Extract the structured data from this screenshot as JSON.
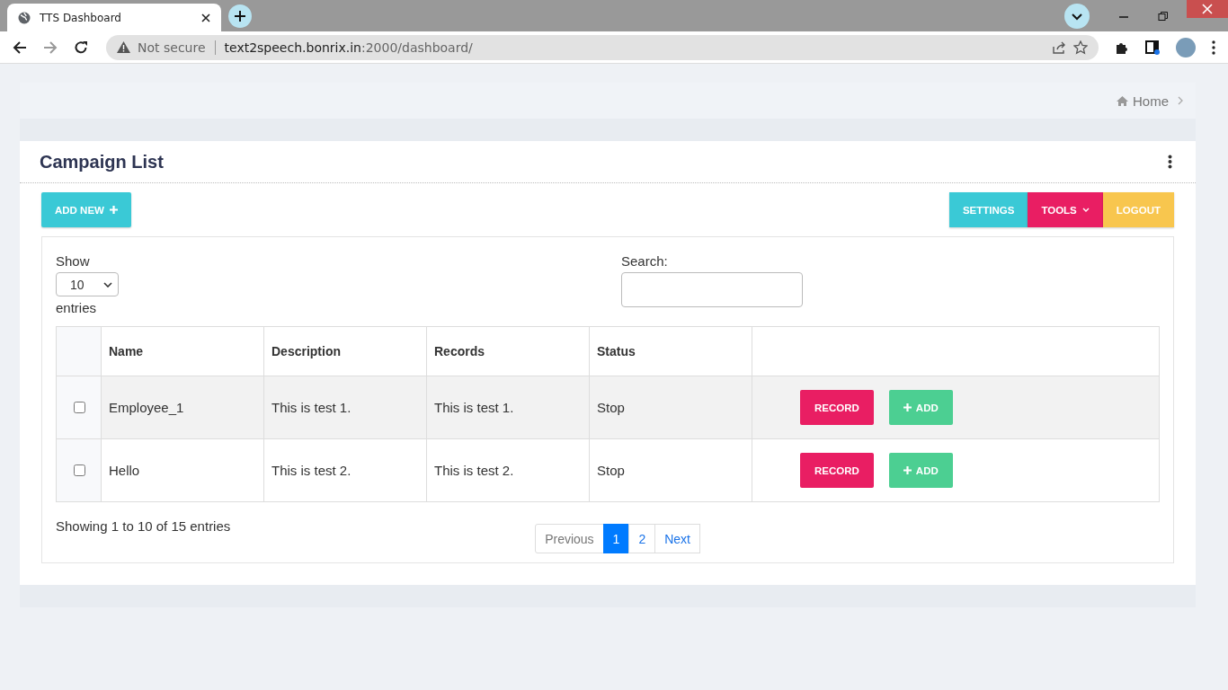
{
  "browser": {
    "tab_title": "TTS Dashboard",
    "security": "Not secure",
    "url_host": "text2speech.bonrix.in",
    "url_path": ":2000/dashboard/"
  },
  "breadcrumb": {
    "label": "Home"
  },
  "card": {
    "title": "Campaign List"
  },
  "toolbar": {
    "add_new": "ADD NEW",
    "buttons": [
      {
        "label": "SETTINGS",
        "kind": "settings"
      },
      {
        "label": "TOOLS",
        "kind": "tools"
      },
      {
        "label": "LOGOUT",
        "kind": "logout"
      }
    ]
  },
  "length_menu": {
    "show": "Show",
    "value": "10",
    "entries": "entries"
  },
  "search": {
    "label": "Search:"
  },
  "table": {
    "columns": [
      "Name",
      "Description",
      "Records",
      "Status"
    ],
    "rows": [
      {
        "checked": false,
        "name": "Employee_1",
        "description": "This is test 1.",
        "records": "This is test 1.",
        "status": "Stop",
        "record_button": "RECORD",
        "add_button": "ADD"
      },
      {
        "checked": false,
        "name": "Hello",
        "description": "This is test 2.",
        "records": "This is test 2.",
        "status": "Stop",
        "record_button": "RECORD",
        "add_button": "ADD"
      }
    ]
  },
  "info": "Showing 1 to 10 of 15 entries",
  "pagination": {
    "previous": "Previous",
    "pages": [
      {
        "label": "1",
        "selected": true
      },
      {
        "label": "2",
        "selected": false
      }
    ],
    "next": "Next"
  }
}
